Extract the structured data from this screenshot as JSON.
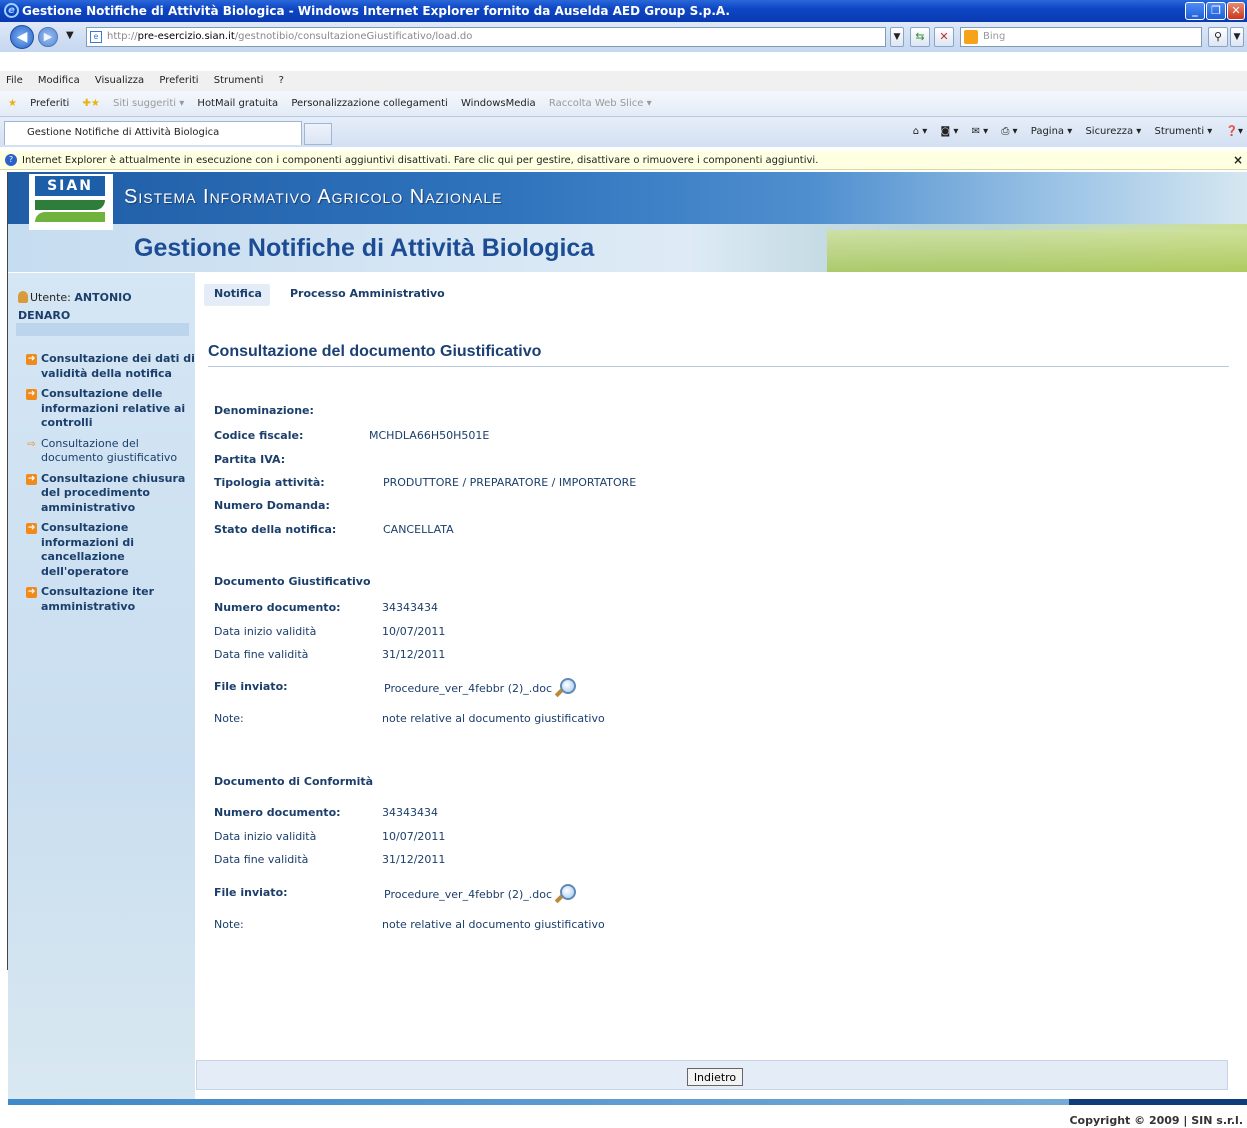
{
  "browser": {
    "window_title": "Gestione Notifiche di Attività Biologica - Windows Internet Explorer fornito da Auselda AED Group S.p.A.",
    "url_prefix": "http://",
    "url_host": "pre-esercizio.sian.it",
    "url_path": "/gestnotibio/consultazioneGiustificativo/load.do",
    "search_placeholder": "Bing",
    "menu": [
      "File",
      "Modifica",
      "Visualizza",
      "Preferiti",
      "Strumenti",
      "?"
    ],
    "favorites": {
      "label": "Preferiti",
      "items": [
        "Siti suggeriti ▾",
        "HotMail gratuita",
        "Personalizzazione collegamenti",
        "WindowsMedia",
        "Raccolta Web Slice ▾"
      ]
    },
    "tab_title": "Gestione Notifiche di Attività Biologica",
    "command_bar": [
      "Pagina ▾",
      "Sicurezza ▾",
      "Strumenti ▾"
    ],
    "infobar_text": "Internet Explorer è attualmente in esecuzione con i componenti aggiuntivi disattivati. Fare clic qui per gestire, disattivare o rimuovere i componenti aggiuntivi."
  },
  "site": {
    "logo_text": "SIAN",
    "system_name": "Sistema Informativo Agricolo Nazionale",
    "app_title": "Gestione Notifiche di Attività Biologica"
  },
  "sidebar": {
    "user_label": "Utente:",
    "user_name_1": "ANTONIO",
    "user_name_2": "DENARO",
    "items": [
      {
        "label": "Consultazione dei dati di validità della notifica",
        "current": false
      },
      {
        "label": "Consultazione delle informazioni relative ai controlli",
        "current": false
      },
      {
        "label": "Consultazione del documento giustificativo",
        "current": true
      },
      {
        "label": "Consultazione chiusura del procedimento amministrativo",
        "current": false
      },
      {
        "label": "Consultazione informazioni di cancellazione dell'operatore",
        "current": false
      },
      {
        "label": "Consultazione iter amministrativo",
        "current": false
      }
    ]
  },
  "tabs": [
    "Notifica",
    "Processo Amministrativo"
  ],
  "page_title": "Consultazione del documento Giustificativo",
  "anagrafica": {
    "denominazione_label": "Denominazione:",
    "denominazione_value": "",
    "cf_label": "Codice fiscale:",
    "cf_value": "MCHDLA66H50H501E",
    "piva_label": "Partita IVA:",
    "piva_value": "",
    "tipologia_label": "Tipologia attività:",
    "tipologia_value": "PRODUTTORE / PREPARATORE / IMPORTATORE",
    "domanda_label": "Numero Domanda:",
    "domanda_value": "",
    "stato_label": "Stato della notifica:",
    "stato_value": "CANCELLATA"
  },
  "doc_giustificativo": {
    "title": "Documento  Giustificativo",
    "numero_label": "Numero documento:",
    "numero_value": "34343434",
    "inizio_label": "Data inizio validità",
    "inizio_value": "10/07/2011",
    "fine_label": "Data fine validità",
    "fine_value": "31/12/2011",
    "file_label": "File inviato:",
    "file_value": "Procedure_ver_4febbr (2)_.doc",
    "note_label": "Note:",
    "note_value": "note relative al documento giustificativo"
  },
  "doc_conformita": {
    "title": "Documento di Conformità",
    "numero_label": "Numero documento:",
    "numero_value": "34343434",
    "inizio_label": "Data inizio validità",
    "inizio_value": "10/07/2011",
    "fine_label": "Data fine validità",
    "fine_value": "31/12/2011",
    "file_label": "File inviato:",
    "file_value": "Procedure_ver_4febbr (2)_.doc",
    "note_label": "Note:",
    "note_value": "note relative al documento giustificativo"
  },
  "back_button": "Indietro",
  "copyright": "Copyright © 2009 | SIN s.r.l."
}
